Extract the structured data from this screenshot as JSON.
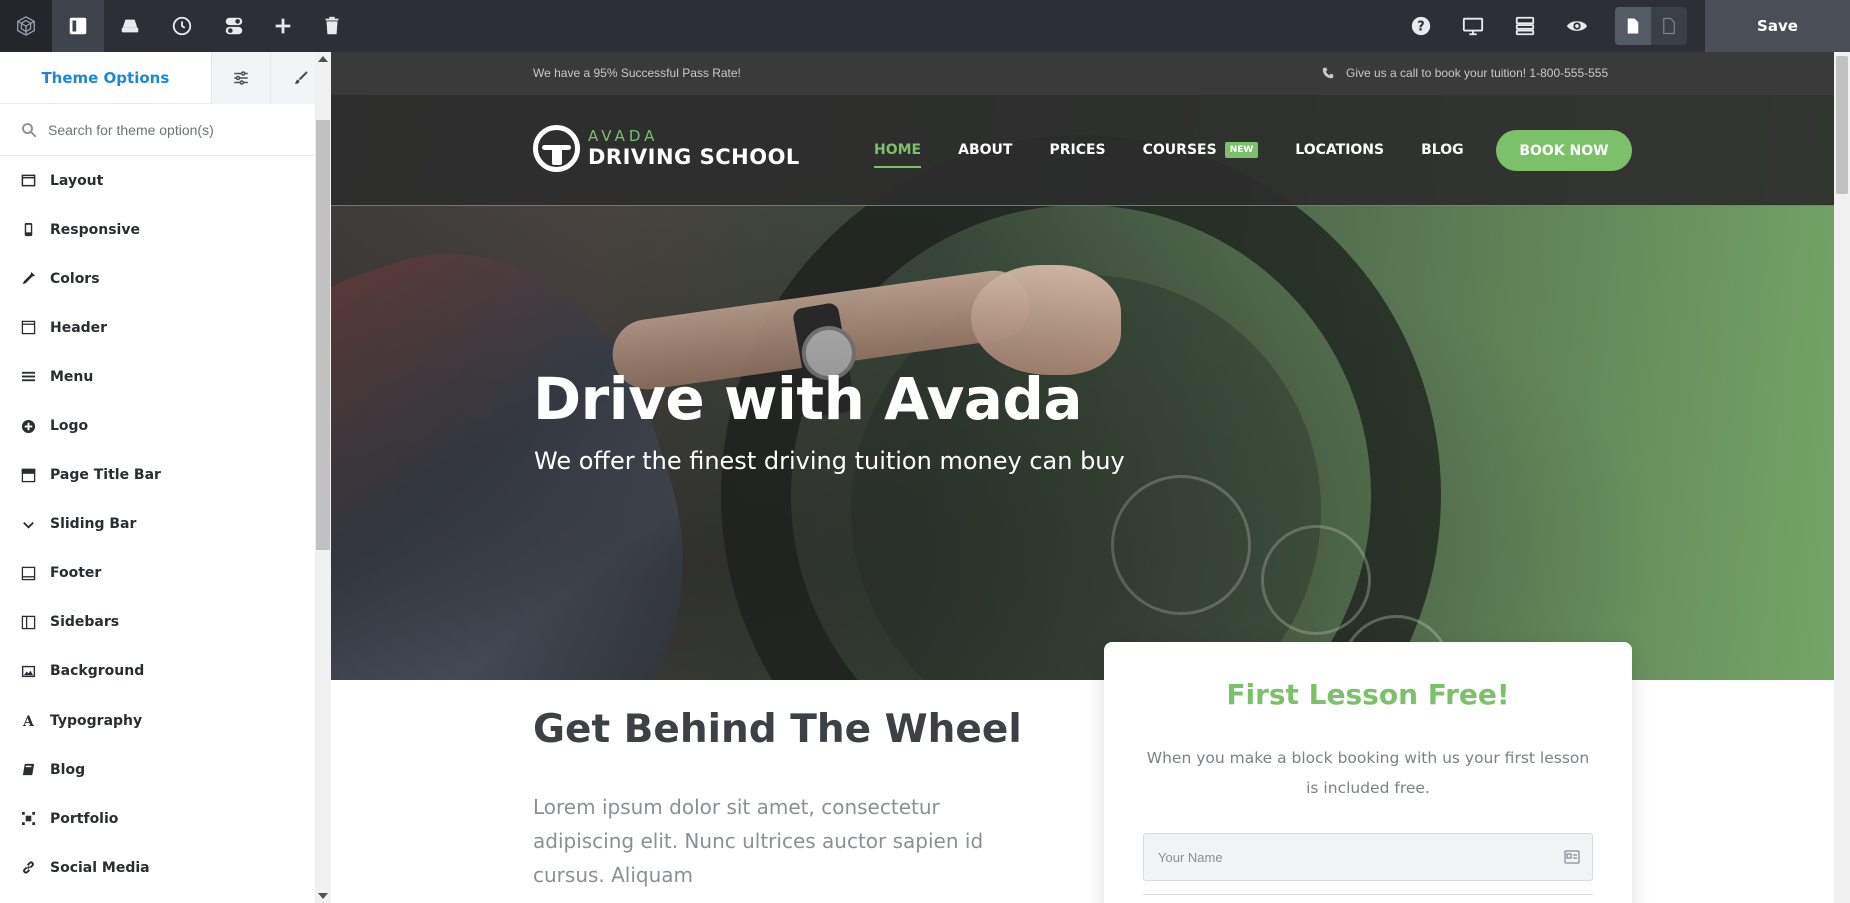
{
  "toolbar": {
    "logo_icon": "builder-logo-icon",
    "tools": [
      "sidebar-toggle-icon",
      "library-icon",
      "history-icon",
      "toggles-icon",
      "add-icon",
      "trash-icon"
    ],
    "right_tools": [
      "help-icon",
      "desktop-preview-icon",
      "layout-icon",
      "eye-icon"
    ],
    "save_label": "Save"
  },
  "sidebar": {
    "tab_title": "Theme Options",
    "search_placeholder": "Search for theme option(s)",
    "items": [
      {
        "label": "Layout",
        "icon": "layout-icon"
      },
      {
        "label": "Responsive",
        "icon": "mobile-icon"
      },
      {
        "label": "Colors",
        "icon": "eyedropper-icon"
      },
      {
        "label": "Header",
        "icon": "header-icon"
      },
      {
        "label": "Menu",
        "icon": "menu-icon"
      },
      {
        "label": "Logo",
        "icon": "plus-circle-icon"
      },
      {
        "label": "Page Title Bar",
        "icon": "title-bar-icon"
      },
      {
        "label": "Sliding Bar",
        "icon": "chevron-down-icon"
      },
      {
        "label": "Footer",
        "icon": "footer-icon"
      },
      {
        "label": "Sidebars",
        "icon": "sidebars-icon"
      },
      {
        "label": "Background",
        "icon": "image-icon"
      },
      {
        "label": "Typography",
        "icon": "font-icon"
      },
      {
        "label": "Blog",
        "icon": "book-icon"
      },
      {
        "label": "Portfolio",
        "icon": "portfolio-icon"
      },
      {
        "label": "Social Media",
        "icon": "link-icon"
      }
    ]
  },
  "site": {
    "topbar_left": "We have a 95% Successful Pass Rate!",
    "topbar_right": "Give us a call to book your tuition! 1-800-555-555",
    "logo_line1": "AVADA",
    "logo_line2": "DRIVING SCHOOL",
    "nav": [
      {
        "label": "HOME",
        "active": true
      },
      {
        "label": "ABOUT"
      },
      {
        "label": "PRICES"
      },
      {
        "label": "COURSES",
        "badge": "NEW"
      },
      {
        "label": "LOCATIONS"
      },
      {
        "label": "BLOG"
      }
    ],
    "cta": "BOOK NOW",
    "hero_title": "Drive with Avada",
    "hero_subtitle": "We offer the finest driving tuition money can buy",
    "section_title": "Get Behind The Wheel",
    "section_text": "Lorem ipsum dolor sit amet, consectetur adipiscing elit. Nunc ultrices auctor sapien id cursus. Aliquam",
    "card_title": "First Lesson Free!",
    "card_text": "When you make a block booking with us your first lesson is included free.",
    "name_placeholder": "Your Name",
    "accent_color": "#7cc06a"
  }
}
